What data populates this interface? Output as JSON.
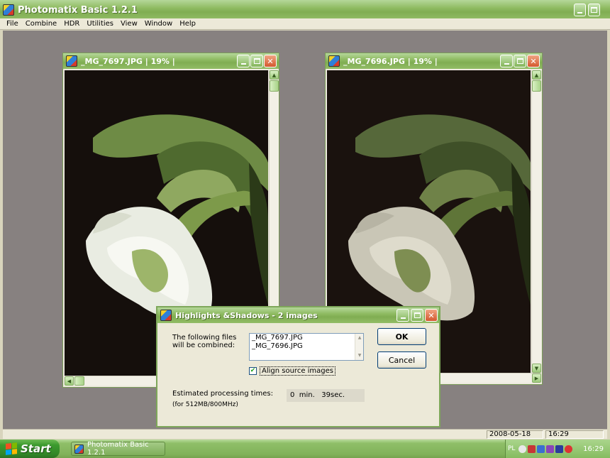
{
  "app": {
    "title": "Photomatix Basic 1.2.1"
  },
  "menu": {
    "items": [
      "File",
      "Combine",
      "HDR",
      "Utilities",
      "View",
      "Window",
      "Help"
    ]
  },
  "image_windows": [
    {
      "title": "_MG_7697.JPG  |  19%  |"
    },
    {
      "title": "_MG_7696.JPG  |  19%  |"
    }
  ],
  "dialog": {
    "title": "Highlights &Shadows - 2 images",
    "files_label_line1": "The following files",
    "files_label_line2": "will be combined:",
    "files": [
      "_MG_7697.JPG",
      "_MG_7696.JPG"
    ],
    "align_label": "Align source images",
    "align_checked": true,
    "ok_label": "OK",
    "cancel_label": "Cancel",
    "est_label": "Estimated processing times:",
    "est_sub": "(for 512MB/800MHz)",
    "est_value": "0  min.   39sec."
  },
  "status": {
    "date": "2008-05-18",
    "time": "16:29"
  },
  "taskbar": {
    "start_label": "Start",
    "task_label": "Photomatix Basic 1.2.1",
    "lang": "PL",
    "clock": "16:29"
  }
}
